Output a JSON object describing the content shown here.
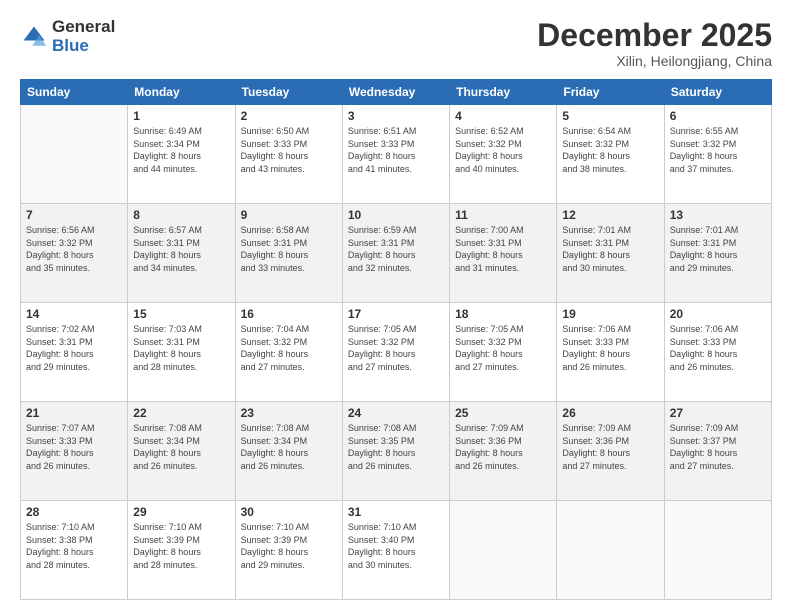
{
  "logo": {
    "general": "General",
    "blue": "Blue"
  },
  "header": {
    "month": "December 2025",
    "location": "Xilin, Heilongjiang, China"
  },
  "days_of_week": [
    "Sunday",
    "Monday",
    "Tuesday",
    "Wednesday",
    "Thursday",
    "Friday",
    "Saturday"
  ],
  "weeks": [
    [
      {
        "day": "",
        "info": ""
      },
      {
        "day": "1",
        "info": "Sunrise: 6:49 AM\nSunset: 3:34 PM\nDaylight: 8 hours\nand 44 minutes."
      },
      {
        "day": "2",
        "info": "Sunrise: 6:50 AM\nSunset: 3:33 PM\nDaylight: 8 hours\nand 43 minutes."
      },
      {
        "day": "3",
        "info": "Sunrise: 6:51 AM\nSunset: 3:33 PM\nDaylight: 8 hours\nand 41 minutes."
      },
      {
        "day": "4",
        "info": "Sunrise: 6:52 AM\nSunset: 3:32 PM\nDaylight: 8 hours\nand 40 minutes."
      },
      {
        "day": "5",
        "info": "Sunrise: 6:54 AM\nSunset: 3:32 PM\nDaylight: 8 hours\nand 38 minutes."
      },
      {
        "day": "6",
        "info": "Sunrise: 6:55 AM\nSunset: 3:32 PM\nDaylight: 8 hours\nand 37 minutes."
      }
    ],
    [
      {
        "day": "7",
        "info": "Sunrise: 6:56 AM\nSunset: 3:32 PM\nDaylight: 8 hours\nand 35 minutes."
      },
      {
        "day": "8",
        "info": "Sunrise: 6:57 AM\nSunset: 3:31 PM\nDaylight: 8 hours\nand 34 minutes."
      },
      {
        "day": "9",
        "info": "Sunrise: 6:58 AM\nSunset: 3:31 PM\nDaylight: 8 hours\nand 33 minutes."
      },
      {
        "day": "10",
        "info": "Sunrise: 6:59 AM\nSunset: 3:31 PM\nDaylight: 8 hours\nand 32 minutes."
      },
      {
        "day": "11",
        "info": "Sunrise: 7:00 AM\nSunset: 3:31 PM\nDaylight: 8 hours\nand 31 minutes."
      },
      {
        "day": "12",
        "info": "Sunrise: 7:01 AM\nSunset: 3:31 PM\nDaylight: 8 hours\nand 30 minutes."
      },
      {
        "day": "13",
        "info": "Sunrise: 7:01 AM\nSunset: 3:31 PM\nDaylight: 8 hours\nand 29 minutes."
      }
    ],
    [
      {
        "day": "14",
        "info": "Sunrise: 7:02 AM\nSunset: 3:31 PM\nDaylight: 8 hours\nand 29 minutes."
      },
      {
        "day": "15",
        "info": "Sunrise: 7:03 AM\nSunset: 3:31 PM\nDaylight: 8 hours\nand 28 minutes."
      },
      {
        "day": "16",
        "info": "Sunrise: 7:04 AM\nSunset: 3:32 PM\nDaylight: 8 hours\nand 27 minutes."
      },
      {
        "day": "17",
        "info": "Sunrise: 7:05 AM\nSunset: 3:32 PM\nDaylight: 8 hours\nand 27 minutes."
      },
      {
        "day": "18",
        "info": "Sunrise: 7:05 AM\nSunset: 3:32 PM\nDaylight: 8 hours\nand 27 minutes."
      },
      {
        "day": "19",
        "info": "Sunrise: 7:06 AM\nSunset: 3:33 PM\nDaylight: 8 hours\nand 26 minutes."
      },
      {
        "day": "20",
        "info": "Sunrise: 7:06 AM\nSunset: 3:33 PM\nDaylight: 8 hours\nand 26 minutes."
      }
    ],
    [
      {
        "day": "21",
        "info": "Sunrise: 7:07 AM\nSunset: 3:33 PM\nDaylight: 8 hours\nand 26 minutes."
      },
      {
        "day": "22",
        "info": "Sunrise: 7:08 AM\nSunset: 3:34 PM\nDaylight: 8 hours\nand 26 minutes."
      },
      {
        "day": "23",
        "info": "Sunrise: 7:08 AM\nSunset: 3:34 PM\nDaylight: 8 hours\nand 26 minutes."
      },
      {
        "day": "24",
        "info": "Sunrise: 7:08 AM\nSunset: 3:35 PM\nDaylight: 8 hours\nand 26 minutes."
      },
      {
        "day": "25",
        "info": "Sunrise: 7:09 AM\nSunset: 3:36 PM\nDaylight: 8 hours\nand 26 minutes."
      },
      {
        "day": "26",
        "info": "Sunrise: 7:09 AM\nSunset: 3:36 PM\nDaylight: 8 hours\nand 27 minutes."
      },
      {
        "day": "27",
        "info": "Sunrise: 7:09 AM\nSunset: 3:37 PM\nDaylight: 8 hours\nand 27 minutes."
      }
    ],
    [
      {
        "day": "28",
        "info": "Sunrise: 7:10 AM\nSunset: 3:38 PM\nDaylight: 8 hours\nand 28 minutes."
      },
      {
        "day": "29",
        "info": "Sunrise: 7:10 AM\nSunset: 3:39 PM\nDaylight: 8 hours\nand 28 minutes."
      },
      {
        "day": "30",
        "info": "Sunrise: 7:10 AM\nSunset: 3:39 PM\nDaylight: 8 hours\nand 29 minutes."
      },
      {
        "day": "31",
        "info": "Sunrise: 7:10 AM\nSunset: 3:40 PM\nDaylight: 8 hours\nand 30 minutes."
      },
      {
        "day": "",
        "info": ""
      },
      {
        "day": "",
        "info": ""
      },
      {
        "day": "",
        "info": ""
      }
    ]
  ]
}
